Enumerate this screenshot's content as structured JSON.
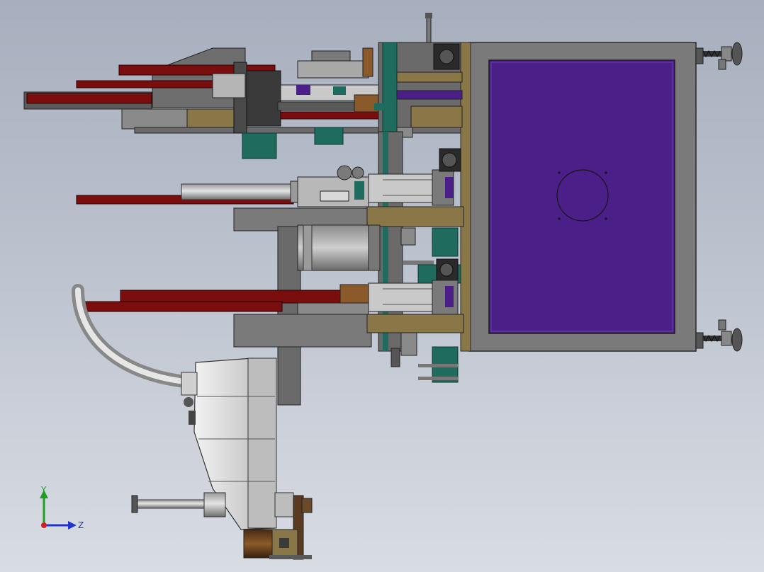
{
  "viewport": {
    "background_top": "#a7afbe",
    "background_bottom": "#d8dce3"
  },
  "model": {
    "frame_color": "#6f6f6f",
    "panel_color": "#4a1f86",
    "rail_color": "#7a0d0d",
    "teal_color": "#1f6b5e",
    "wood_color": "#8a7748",
    "motor_housing_color": "#d8d8d8"
  },
  "triad": {
    "y_label": "Y",
    "z_label": "Z",
    "y_color": "#1f9e1f",
    "z_color": "#2233cc",
    "origin_color": "#cc2222"
  }
}
